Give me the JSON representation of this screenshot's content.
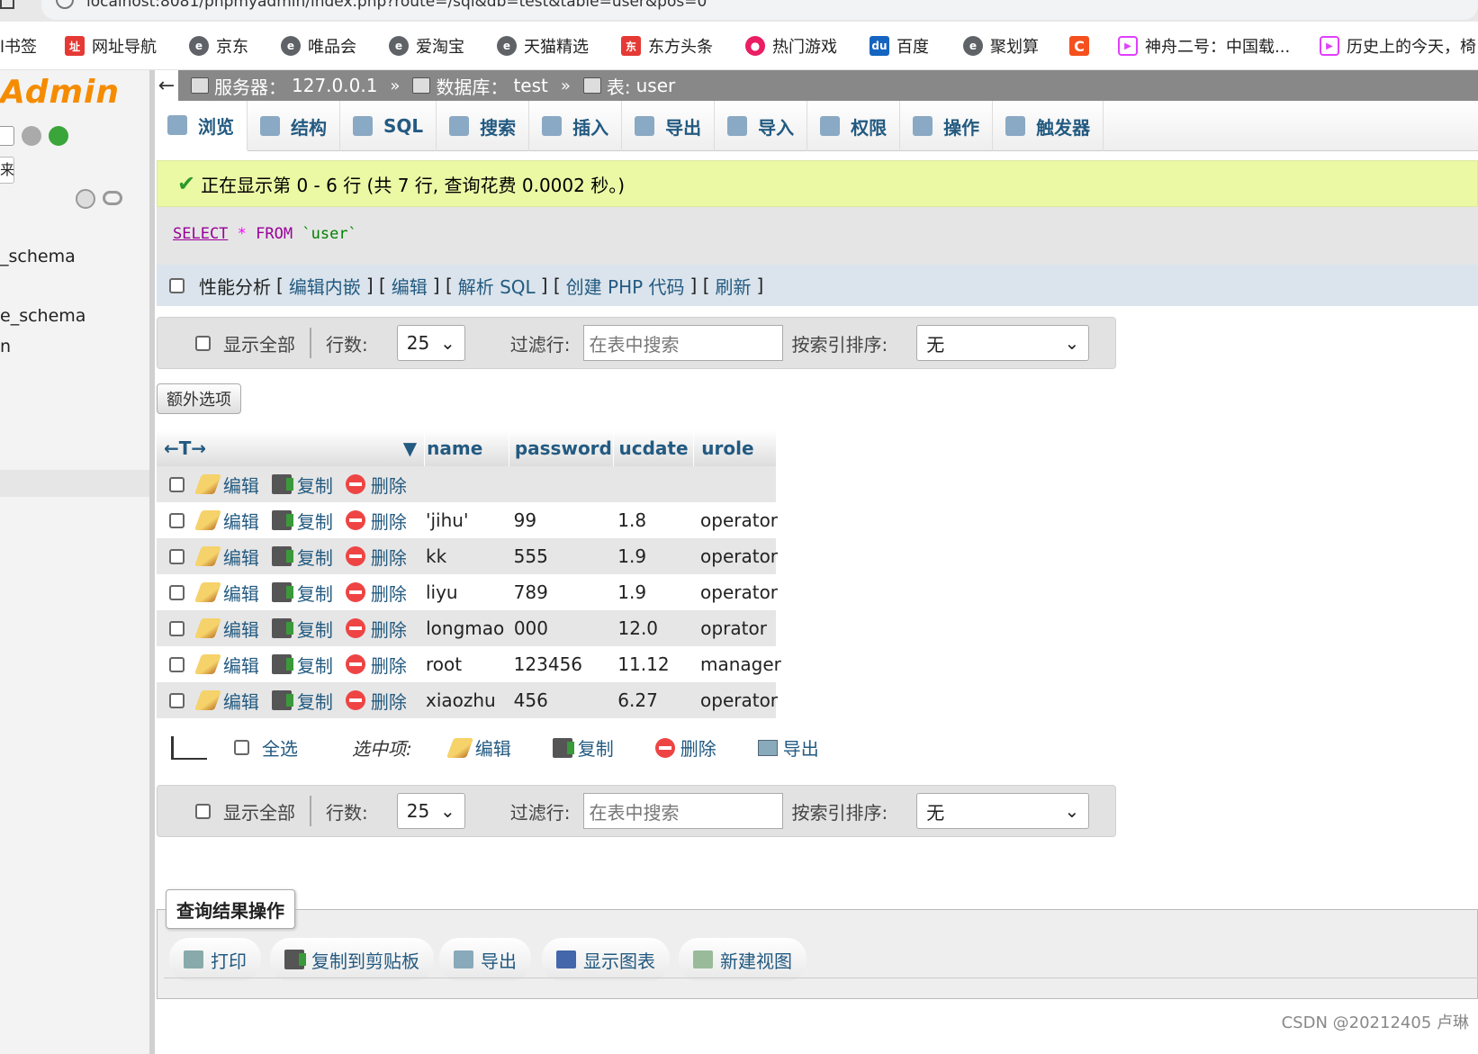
{
  "browser": {
    "url": "localhost:8081/phpmyadmin/index.php?route=/sql&db=test&table=user&pos=0",
    "bookmarks": [
      "l书签",
      "网址导航",
      "京东",
      "唯品会",
      "爱淘宝",
      "天猫精选",
      "东方头条",
      "热门游戏",
      "百度",
      "聚划算",
      "C",
      "神舟二号：中国载...",
      "历史上的今天，椅"
    ]
  },
  "nav": {
    "logo": "Admin",
    "btn_small": "来",
    "db_items": [
      "_schema",
      "e_schema",
      "n"
    ]
  },
  "breadcrumb": {
    "server_label": "服务器：",
    "server": "127.0.0.1",
    "db_label": "数据库：",
    "db": "test",
    "table_label": "表:",
    "table": "user",
    "sep": "»",
    "back": "←"
  },
  "tabs": [
    "浏览",
    "结构",
    "SQL",
    "搜索",
    "插入",
    "导出",
    "导入",
    "权限",
    "操作",
    "触发器"
  ],
  "success_msg": "正在显示第 0 - 6 行 (共 7 行, 查询花费 0.0002 秒。)",
  "sql": {
    "kw1": "SELECT",
    "star": "*",
    "kw2": "FROM",
    "table": "`user`"
  },
  "profiling": {
    "label": "性能分析",
    "links": [
      "编辑内嵌",
      "编辑",
      "解析 SQL",
      "创建 PHP 代码",
      "刷新"
    ]
  },
  "navbar": {
    "show_all": "显示全部",
    "rows_label": "行数:",
    "rows_value": "25",
    "filter_label": "过滤行:",
    "filter_placeholder": "在表中搜索",
    "sort_label": "按索引排序:",
    "sort_value": "无"
  },
  "extra_options": "额外选项",
  "table": {
    "lead_arrows": "←T→",
    "columns": [
      "name",
      "password",
      "ucdate",
      "urole"
    ],
    "actions": {
      "edit": "编辑",
      "copy": "复制",
      "delete": "删除"
    },
    "rows": [
      [
        "",
        "",
        "",
        ""
      ],
      [
        "'jihu'",
        "99",
        "1.8",
        "operator"
      ],
      [
        "kk",
        "555",
        "1.9",
        "operator"
      ],
      [
        "liyu",
        "789",
        "1.9",
        "operator"
      ],
      [
        "longmao",
        "000",
        "12.0",
        "oprator"
      ],
      [
        "root",
        "123456",
        "11.12",
        "manager"
      ],
      [
        "xiaozhu",
        "456",
        "6.27",
        "operator"
      ]
    ]
  },
  "bulk": {
    "select_all": "全选",
    "with_selected": "选中项:",
    "edit": "编辑",
    "copy": "复制",
    "delete": "删除",
    "export": "导出"
  },
  "query_ops": {
    "legend": "查询结果操作",
    "print": "打印",
    "copy_clipboard": "复制到剪贴板",
    "export": "导出",
    "chart": "显示图表",
    "new_view": "新建视图"
  },
  "watermark": "CSDN @20212405 卢琳"
}
